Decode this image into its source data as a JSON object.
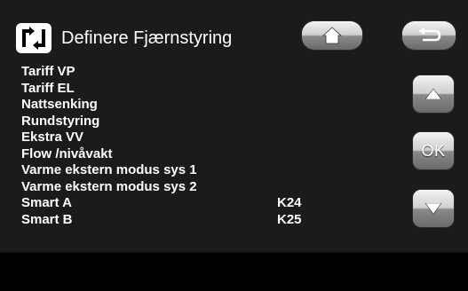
{
  "header": {
    "title": "Definere Fjærnstyring",
    "icon": "remote-control-icon",
    "home_icon": "home-icon",
    "back_icon": "return-arrow-icon"
  },
  "side_buttons": {
    "up_icon": "arrow-up-icon",
    "ok_label": "OK",
    "down_icon": "arrow-down-icon"
  },
  "list": {
    "items": [
      {
        "label": "Tariff VP",
        "value": ""
      },
      {
        "label": "Tariff EL",
        "value": ""
      },
      {
        "label": "Nattsenking",
        "value": ""
      },
      {
        "label": "Rundstyring",
        "value": ""
      },
      {
        "label": "Ekstra VV",
        "value": ""
      },
      {
        "label": "Flow /nivåvakt",
        "value": ""
      },
      {
        "label": "Varme ekstern modus sys 1",
        "value": ""
      },
      {
        "label": "Varme ekstern modus sys 2",
        "value": ""
      },
      {
        "label": "Smart A",
        "value": "K24"
      },
      {
        "label": "Smart B",
        "value": "K25"
      }
    ]
  },
  "colors": {
    "background": "#1b1b1b",
    "text": "#ffffff",
    "button": "#c8c8c8"
  }
}
